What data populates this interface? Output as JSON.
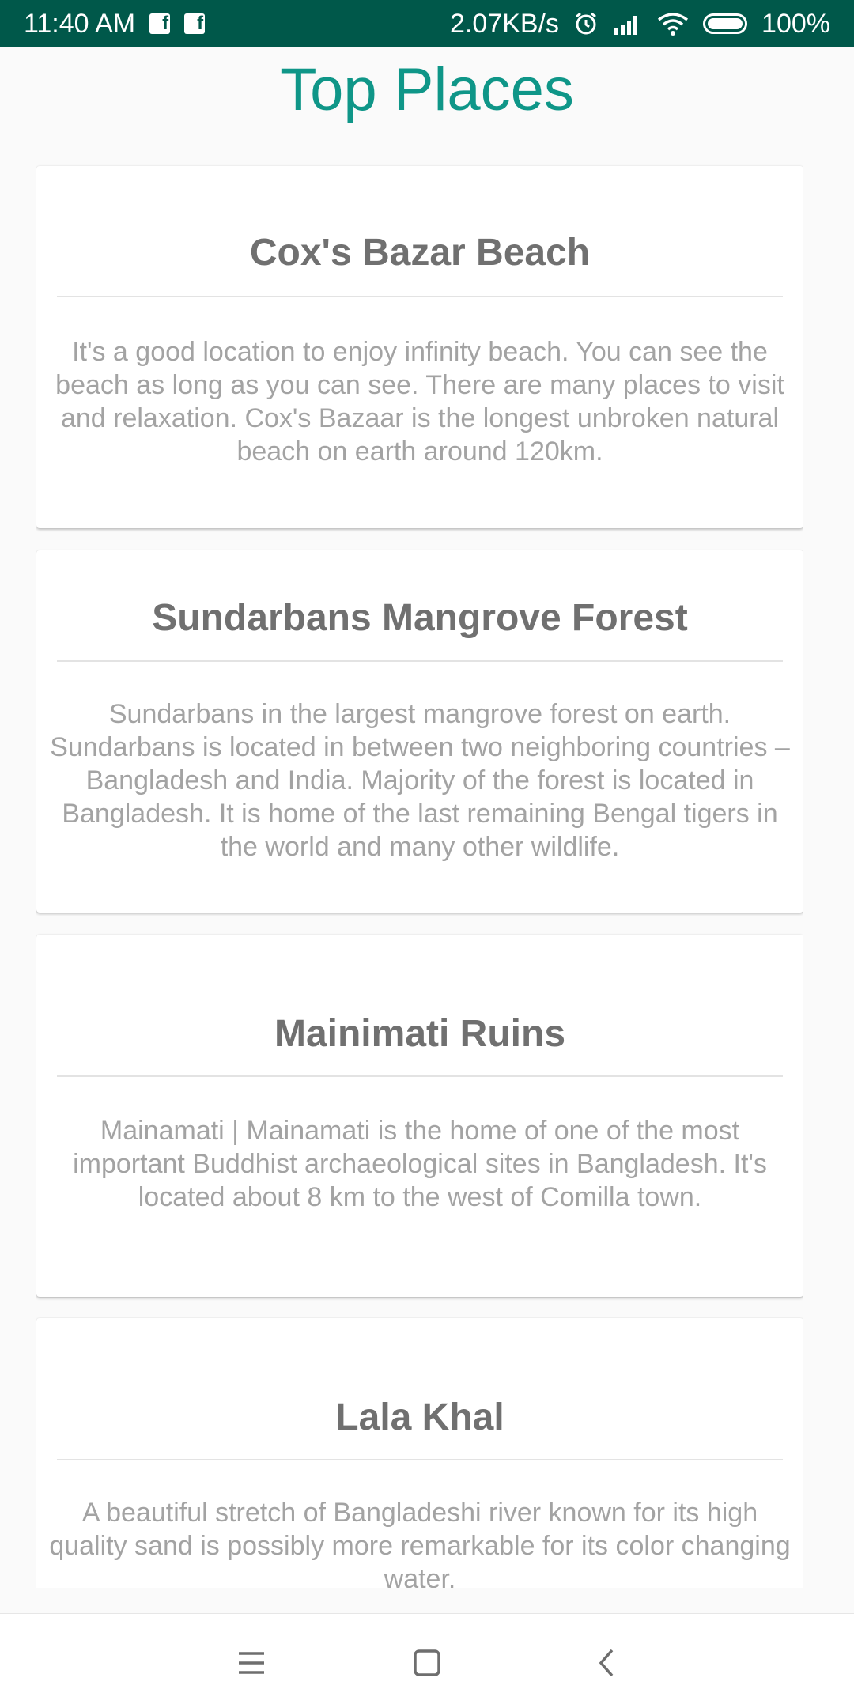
{
  "status_bar": {
    "time": "11:40 AM",
    "network_speed": "2.07KB/s",
    "battery": "100%",
    "icons": [
      "facebook-icon",
      "facebook-icon",
      "alarm-icon",
      "signal-icon",
      "wifi-icon",
      "battery-icon"
    ]
  },
  "page": {
    "title": "Top Places"
  },
  "places": [
    {
      "title": "Cox's Bazar Beach",
      "description": "It's a good location to enjoy infinity beach. You can see the beach as long as you can see. There are many places to visit and relaxation. Cox's Bazaar is the longest unbroken natural beach on earth around 120km."
    },
    {
      "title": "Sundarbans Mangrove Forest",
      "description": "Sundarbans in the largest mangrove forest on earth. Sundarbans is located in between two neighboring countries – Bangladesh and India. Majority of the forest is located in Bangladesh. It is home of the last remaining Bengal tigers in the world and many other wildlife."
    },
    {
      "title": "Mainimati Ruins",
      "description": "Mainamati | Mainamati is the home of one of the most important Buddhist archaeological sites in Bangladesh. It's located about 8 km to the west of Comilla town."
    },
    {
      "title": "Lala Khal",
      "description": "A beautiful stretch of Bangladeshi river known for its high quality sand is possibly more remarkable for its color changing water."
    }
  ],
  "nav_bar": {
    "icons": [
      "menu-icon",
      "home-square-icon",
      "back-chevron-icon"
    ]
  },
  "colors": {
    "status_bar": "#00584a",
    "title": "#0f9688",
    "card_title": "#707070",
    "card_text": "#a3a3a3"
  }
}
